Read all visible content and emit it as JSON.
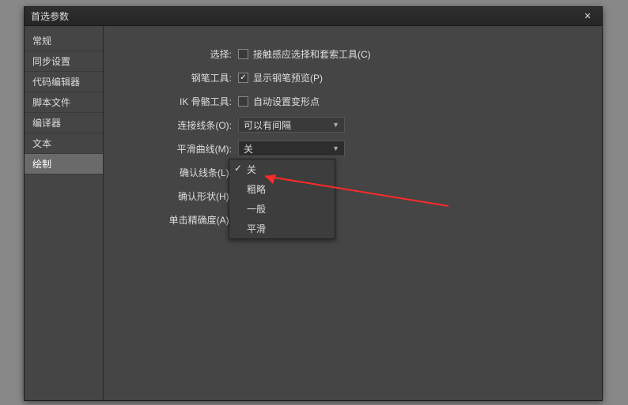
{
  "window": {
    "title": "首选参数"
  },
  "sidebar": {
    "items": [
      {
        "label": "常规"
      },
      {
        "label": "同步设置"
      },
      {
        "label": "代码编辑器"
      },
      {
        "label": "脚本文件"
      },
      {
        "label": "编译器"
      },
      {
        "label": "文本"
      },
      {
        "label": "绘制"
      }
    ],
    "selected_index": 6
  },
  "form": {
    "select_label": "选择:",
    "select_check_label": "接触感应选择和套索工具(C)",
    "select_checked": false,
    "pen_label": "钢笔工具:",
    "pen_check_label": "显示钢笔预览(P)",
    "pen_checked": true,
    "ik_label": "IK 骨骼工具:",
    "ik_check_label": "自动设置变形点",
    "ik_checked": false,
    "connect_label": "连接线条(O):",
    "connect_value": "可以有间隔",
    "smooth_label": "平滑曲线(M):",
    "smooth_value": "关",
    "confirm_line_label": "确认线条(L):",
    "confirm_shape_label": "确认形状(H):",
    "click_accuracy_label": "单击精确度(A):"
  },
  "dropdown_options": [
    {
      "label": "关",
      "selected": true
    },
    {
      "label": "粗略",
      "selected": false
    },
    {
      "label": "一般",
      "selected": false
    },
    {
      "label": "平滑",
      "selected": false
    }
  ]
}
